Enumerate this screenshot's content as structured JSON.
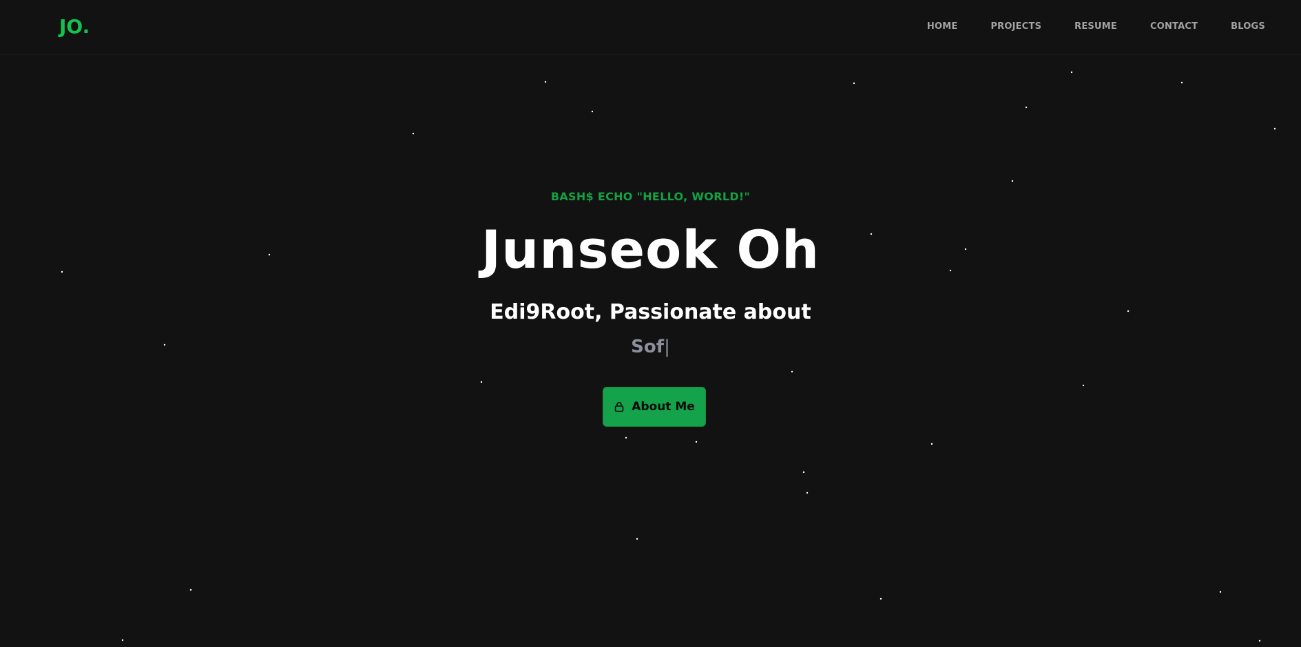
{
  "logo": {
    "text": "JO."
  },
  "nav": {
    "items": [
      {
        "label": "HOME"
      },
      {
        "label": "PROJECTS"
      },
      {
        "label": "RESUME"
      },
      {
        "label": "CONTACT"
      },
      {
        "label": "BLOGS"
      }
    ]
  },
  "hero": {
    "command": "BASH$ ECHO \"HELLO, WORLD!\"",
    "name": "Junseok Oh",
    "tagline": "Edi9Root, Passionate about",
    "typed_text": "Sof",
    "cursor": "|",
    "button_label": "About Me",
    "button_icon": "lock-icon"
  },
  "colors": {
    "background": "#121212",
    "accent": "#16c24f",
    "button": "#14a34a",
    "muted": "#8d8f9c"
  }
}
